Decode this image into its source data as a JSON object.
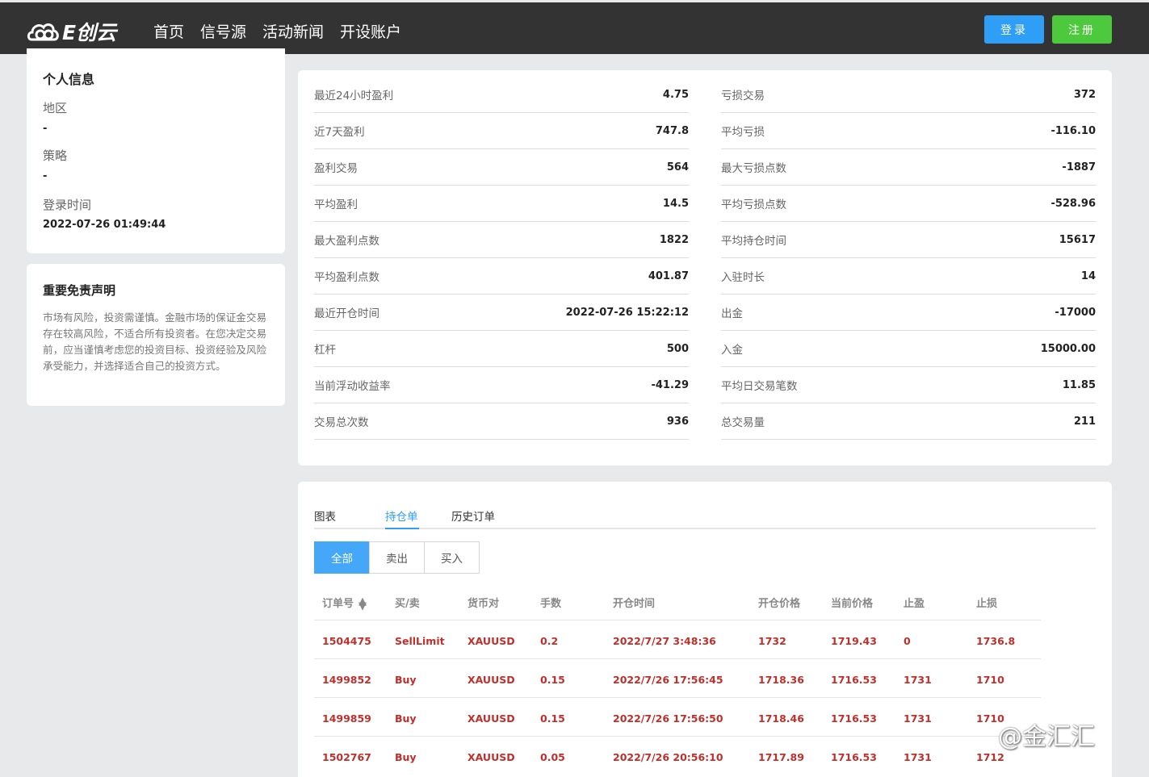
{
  "header": {
    "logo_text": "E创云",
    "nav": [
      "首页",
      "信号源",
      "活动新闻",
      "开设账户"
    ],
    "login_label": "登录",
    "register_label": "注册"
  },
  "profile": {
    "title": "个人信息",
    "region_label": "地区",
    "region_value": "-",
    "strategy_label": "策略",
    "strategy_value": "-",
    "login_time_label": "登录时间",
    "login_time_value": "2022-07-26 01:49:44"
  },
  "disclaimer": {
    "title": "重要免责声明",
    "text": "市场有风险，投资需谨慎。金融市场的保证金交易存在较高风险，不适合所有投资者。在您决定交易前，应当谨慎考虑您的投资目标、投资经验及风险承受能力，并选择适合自己的投资方式。"
  },
  "stats_left": [
    {
      "label": "最近24小时盈利",
      "value": "4.75"
    },
    {
      "label": "近7天盈利",
      "value": "747.8"
    },
    {
      "label": "盈利交易",
      "value": "564"
    },
    {
      "label": "平均盈利",
      "value": "14.5"
    },
    {
      "label": "最大盈利点数",
      "value": "1822"
    },
    {
      "label": "平均盈利点数",
      "value": "401.87"
    },
    {
      "label": "最近开仓时间",
      "value": "2022-07-26 15:22:12"
    },
    {
      "label": "杠杆",
      "value": "500"
    },
    {
      "label": "当前浮动收益率",
      "value": "-41.29"
    },
    {
      "label": "交易总次数",
      "value": "936"
    }
  ],
  "stats_right": [
    {
      "label": "亏损交易",
      "value": "372"
    },
    {
      "label": "平均亏损",
      "value": "-116.10"
    },
    {
      "label": "最大亏损点数",
      "value": "-1887"
    },
    {
      "label": "平均亏损点数",
      "value": "-528.96"
    },
    {
      "label": "平均持仓时间",
      "value": "15617"
    },
    {
      "label": "入驻时长",
      "value": "14"
    },
    {
      "label": "出金",
      "value": "-17000"
    },
    {
      "label": "入金",
      "value": "15000.00"
    },
    {
      "label": "平均日交易笔数",
      "value": "11.85"
    },
    {
      "label": "总交易量",
      "value": "211"
    }
  ],
  "tabs": [
    "图表",
    "持仓单",
    "历史订单"
  ],
  "active_tab": "持仓单",
  "filters": [
    "全部",
    "卖出",
    "买入"
  ],
  "active_filter": "全部",
  "table": {
    "headers": [
      "订单号",
      "买/卖",
      "货币对",
      "手数",
      "开仓时间",
      "开仓价格",
      "当前价格",
      "止盈",
      "止损"
    ],
    "rows": [
      [
        "1504475",
        "SellLimit",
        "XAUUSD",
        "0.2",
        "2022/7/27 3:48:36",
        "1732",
        "1719.43",
        "0",
        "1736.8"
      ],
      [
        "1499852",
        "Buy",
        "XAUUSD",
        "0.15",
        "2022/7/26 17:56:45",
        "1718.36",
        "1716.53",
        "1731",
        "1710"
      ],
      [
        "1499859",
        "Buy",
        "XAUUSD",
        "0.15",
        "2022/7/26 17:56:50",
        "1718.46",
        "1716.53",
        "1731",
        "1710"
      ],
      [
        "1502767",
        "Buy",
        "XAUUSD",
        "0.05",
        "2022/7/26 20:56:10",
        "1717.89",
        "1716.53",
        "1731",
        "1712"
      ]
    ]
  },
  "watermark": "@金汇汇",
  "colors": {
    "header_bg": "#333333",
    "login_btn": "#2e9ef7",
    "register_btn": "#4cc93c",
    "accent": "#2e9ef7",
    "order_text": "#c0302b"
  }
}
